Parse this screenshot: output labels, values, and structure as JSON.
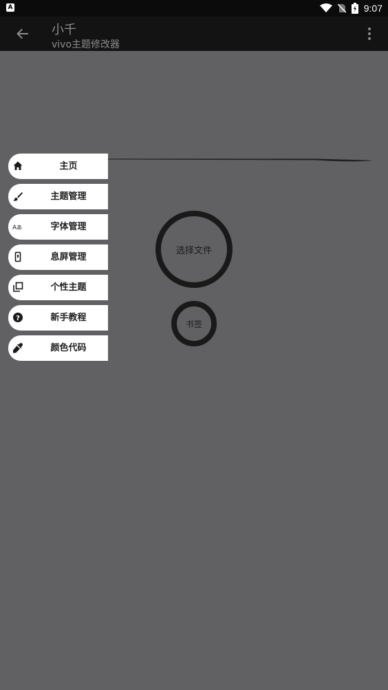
{
  "status_bar": {
    "time": "9:07",
    "left_icon_letter": "A"
  },
  "app_bar": {
    "title": "小千",
    "subtitle": "vivo主题修改器"
  },
  "nav_menu": [
    {
      "label": "主页",
      "icon": "home-icon"
    },
    {
      "label": "主题管理",
      "icon": "brush-icon"
    },
    {
      "label": "字体管理",
      "icon": "font-icon"
    },
    {
      "label": "息屏管理",
      "icon": "phone-icon"
    },
    {
      "label": "个性主题",
      "icon": "copy-icon"
    },
    {
      "label": "新手教程",
      "icon": "help-icon"
    },
    {
      "label": "颜色代码",
      "icon": "eyedropper-icon"
    }
  ],
  "main": {
    "select_file_label": "选择文件",
    "bookmark_label": "书签"
  },
  "colors": {
    "background": "#616163",
    "app_bar": "#131313",
    "status_bar": "#0b0b0b",
    "nav_item": "#ffffff",
    "ring": "#191919"
  }
}
